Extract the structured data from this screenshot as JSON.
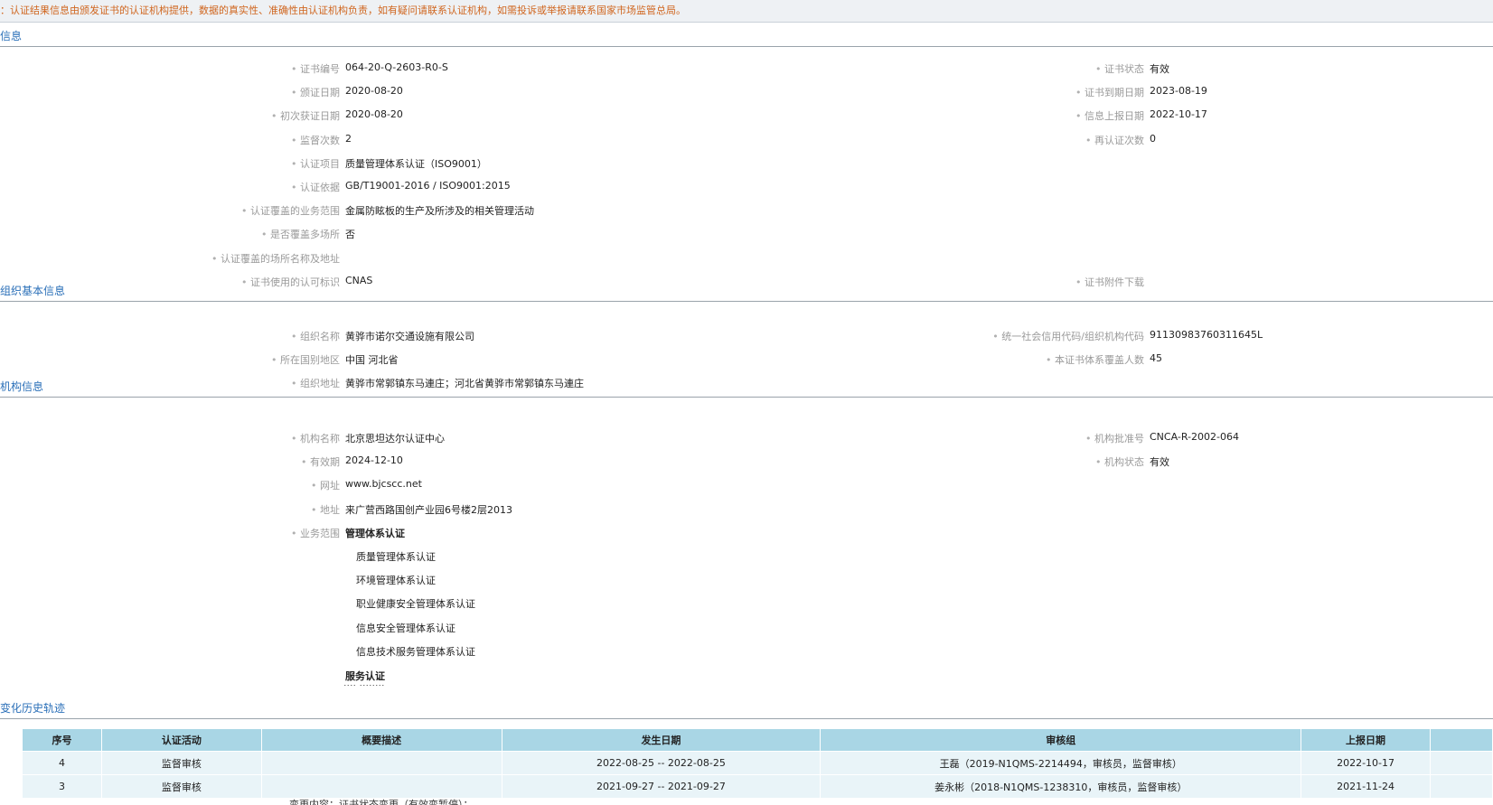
{
  "notice": "：认证结果信息由颁发证书的认证机构提供，数据的真实性、准确性由认证机构负责，如有疑问请联系认证机构，如需投诉或举报请联系国家市场监管总局。",
  "sections": {
    "cert": "信息",
    "org": "组织基本信息",
    "agency": "机构信息",
    "history": "变化历史轨迹"
  },
  "cert": {
    "left": [
      {
        "label": "证书编号",
        "value": "064-20-Q-2603-R0-S"
      },
      {
        "label": "颁证日期",
        "value": "2020-08-20"
      },
      {
        "label": "初次获证日期",
        "value": "2020-08-20"
      },
      {
        "label": "监督次数",
        "value": "2"
      },
      {
        "label": "认证项目",
        "value": "质量管理体系认证（ISO9001）"
      },
      {
        "label": "认证依据",
        "value": "GB/T19001-2016 / ISO9001:2015"
      },
      {
        "label": "认证覆盖的业务范围",
        "value": "金属防眩板的生产及所涉及的相关管理活动"
      },
      {
        "label": "是否覆盖多场所",
        "value": "否"
      },
      {
        "label": "认证覆盖的场所名称及地址",
        "value": ""
      },
      {
        "label": "证书使用的认可标识",
        "value": "CNAS"
      }
    ],
    "right": [
      {
        "label": "证书状态",
        "value": "有效"
      },
      {
        "label": "证书到期日期",
        "value": "2023-08-19"
      },
      {
        "label": "信息上报日期",
        "value": "2022-10-17"
      },
      {
        "label": "再认证次数",
        "value": "0"
      },
      {
        "label": "证书附件下载",
        "value": ""
      }
    ]
  },
  "org": {
    "left": [
      {
        "label": "组织名称",
        "value": "黄骅市诺尔交通设施有限公司"
      },
      {
        "label": "所在国别地区",
        "value": "中国 河北省"
      },
      {
        "label": "组织地址",
        "value": "黄骅市常郭镇东马連庄；河北省黄骅市常郭镇东马連庄"
      }
    ],
    "right": [
      {
        "label": "统一社会信用代码/组织机构代码",
        "value": "91130983760311645L"
      },
      {
        "label": "本证书体系覆盖人数",
        "value": "45"
      }
    ]
  },
  "agency": {
    "left": [
      {
        "label": "机构名称",
        "value": "北京思坦达尔认证中心"
      },
      {
        "label": "有效期",
        "value": "2024-12-10"
      },
      {
        "label": "网址",
        "value": "www.bjcscc.net"
      },
      {
        "label": "地址",
        "value": "来广营西路国创产业园6号楼2层2013"
      },
      {
        "label": "业务范围",
        "value": "管理体系认证"
      }
    ],
    "right": [
      {
        "label": "机构批准号",
        "value": "CNCA-R-2002-064"
      },
      {
        "label": "机构状态",
        "value": "有效"
      }
    ],
    "scope_items": [
      "质量管理体系认证",
      "环境管理体系认证",
      "职业健康安全管理体系认证",
      "信息安全管理体系认证",
      "信息技术服务管理体系认证"
    ],
    "scope_group2": "服务认证"
  },
  "history": {
    "columns": [
      "序号",
      "认证活动",
      "概要描述",
      "发生日期",
      "审核组",
      "上报日期",
      ""
    ],
    "rows": [
      [
        "4",
        "监督审核",
        "",
        "2022-08-25 -- 2022-08-25",
        "王磊（2019-N1QMS-2214494，审核员，监督审核）",
        "2022-10-17",
        ""
      ],
      [
        "3",
        "监督审核",
        "",
        "2021-09-27 -- 2021-09-27",
        "姜永彬（2018-N1QMS-1238310，审核员，监督审核）",
        "2021-11-24",
        ""
      ]
    ],
    "partial_text": "变更内容：证书状态变更（有效变暂停）："
  }
}
